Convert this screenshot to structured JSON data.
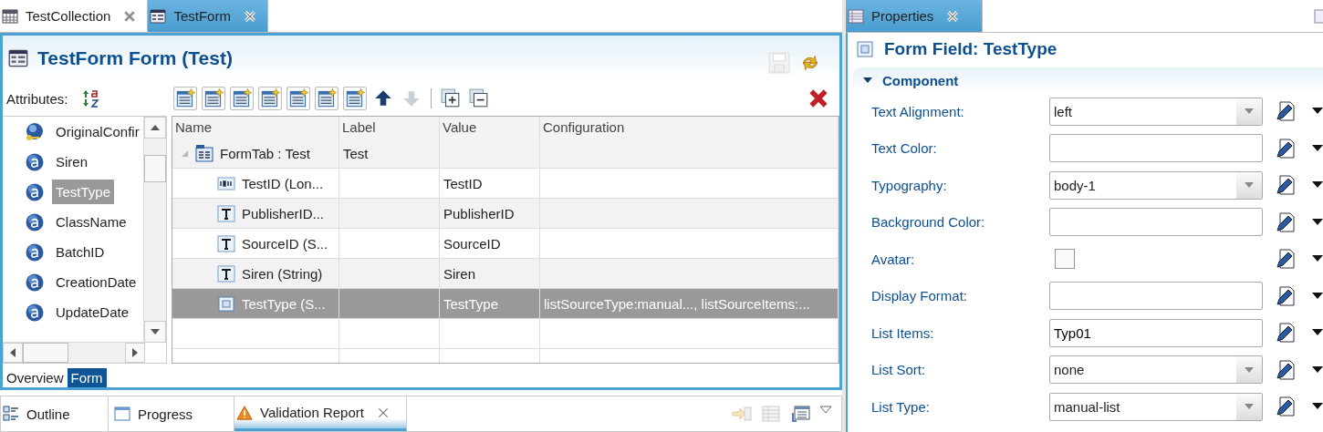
{
  "editor_tabs": [
    {
      "label": "TestCollection",
      "selected": false,
      "kind": "collection",
      "closable": true
    },
    {
      "label": "TestForm",
      "selected": true,
      "kind": "form",
      "closable": true
    }
  ],
  "editor": {
    "title": "TestForm Form (Test)",
    "attributes_label": "Attributes:",
    "attributes": [
      {
        "name": "OriginalConfir",
        "kind": "key",
        "selected": false
      },
      {
        "name": "Siren",
        "kind": "attribute",
        "selected": false
      },
      {
        "name": "TestType",
        "kind": "attribute",
        "selected": true
      },
      {
        "name": "ClassName",
        "kind": "attribute",
        "selected": false
      },
      {
        "name": "BatchID",
        "kind": "attribute",
        "selected": false
      },
      {
        "name": "CreationDate",
        "kind": "attribute",
        "selected": false
      },
      {
        "name": "UpdateDate",
        "kind": "attribute",
        "selected": false
      }
    ],
    "table": {
      "columns": [
        "Name",
        "Label",
        "Value",
        "Configuration"
      ],
      "rows": [
        {
          "name": "FormTab : Test",
          "label": "Test",
          "kind": "tab",
          "expanded": true,
          "selected": false,
          "children": [
            {
              "name": "TestID (Lon...",
              "value": "TestID",
              "kind": "number",
              "selected": false
            },
            {
              "name": "PublisherID...",
              "value": "PublisherID",
              "kind": "text",
              "selected": false
            },
            {
              "name": "SourceID (S...",
              "value": "SourceID",
              "kind": "text",
              "selected": false
            },
            {
              "name": "Siren (String)",
              "value": "Siren",
              "kind": "text",
              "selected": false
            },
            {
              "name": "TestType (S...",
              "value": "TestType",
              "configuration": "listSourceType:manual..., listSourceItems:...",
              "kind": "list",
              "selected": true
            }
          ]
        }
      ]
    },
    "page_tabs": [
      {
        "label": "Overview",
        "selected": false
      },
      {
        "label": "Form",
        "selected": true
      }
    ]
  },
  "bottom_tabs": [
    {
      "label": "Outline",
      "selected": false,
      "kind": "outline",
      "closable": false
    },
    {
      "label": "Progress",
      "selected": false,
      "kind": "progress",
      "closable": false
    },
    {
      "label": "Validation Report",
      "selected": true,
      "kind": "warning",
      "closable": true
    }
  ],
  "properties": {
    "tab": {
      "label": "Properties",
      "selected": true,
      "closable": true
    },
    "title": "Form Field: TestType",
    "section": {
      "title": "Component",
      "expanded": true
    },
    "fields": [
      {
        "label": "Text Alignment:",
        "kind": "combo",
        "value": "left"
      },
      {
        "label": "Text Color:",
        "kind": "text"
      },
      {
        "label": "Typography:",
        "kind": "combo",
        "value": "body-1"
      },
      {
        "label": "Background Color:",
        "kind": "text"
      },
      {
        "label": "Avatar:",
        "kind": "checkbox",
        "checked": false
      },
      {
        "label": "Display Format:",
        "kind": "text"
      },
      {
        "label": "List Items:",
        "kind": "text",
        "value": "Typ01"
      },
      {
        "label": "List Sort:",
        "kind": "combo",
        "value": "none"
      },
      {
        "label": "List Type:",
        "kind": "combo",
        "value": "manual-list"
      }
    ]
  }
}
